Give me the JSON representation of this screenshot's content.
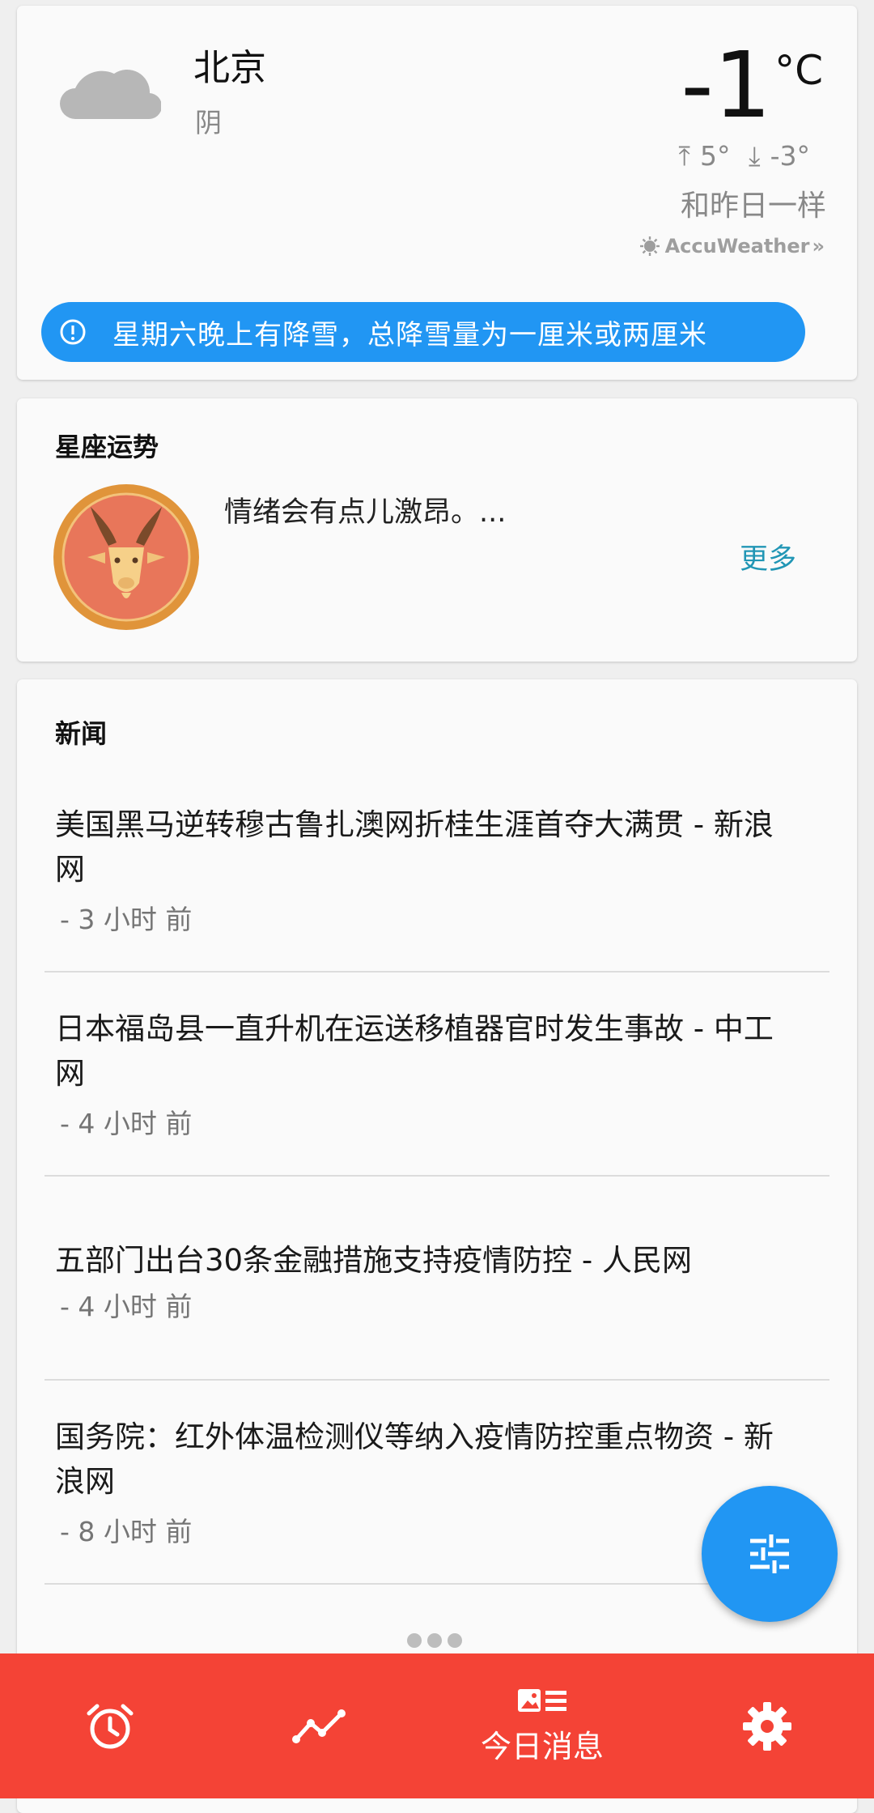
{
  "weather": {
    "city": "北京",
    "condition": "阴",
    "temperature": "-1",
    "unit": "°C",
    "high": "5°",
    "low": "-3°",
    "comparison": "和昨日一样",
    "provider": "AccuWeather",
    "alert": "星期六晚上有降雪，总降雪量为一厘米或两厘米",
    "alert_color": "#2196f3"
  },
  "horoscope": {
    "title": "星座运势",
    "sign_icon": "capricorn-goat-icon",
    "text": "情绪会有点儿激昂。...",
    "more": "更多"
  },
  "news": {
    "title": "新闻",
    "items": [
      {
        "title": "美国黑马逆转穆古鲁扎澳网折桂生涯首夺大满贯 - 新浪网",
        "time": "- 3 小时 前"
      },
      {
        "title": "日本福岛县一直升机在运送移植器官时发生事故 - 中工网",
        "time": "- 4 小时 前"
      },
      {
        "title": "五部门出台30条金融措施支持疫情防控 - 人民网",
        "time": "- 4 小时 前"
      },
      {
        "title": "国务院：红外体温检测仪等纳入疫情防控重点物资 - 新浪网",
        "time": "- 8 小时 前"
      }
    ]
  },
  "fab": {
    "icon": "tune-sliders-icon"
  },
  "bottom_nav": {
    "color": "#f44336",
    "items": [
      {
        "icon": "alarm-clock-icon",
        "label": ""
      },
      {
        "icon": "trend-line-icon",
        "label": ""
      },
      {
        "icon": "news-icon",
        "label": "今日消息"
      },
      {
        "icon": "gear-icon",
        "label": ""
      }
    ]
  }
}
